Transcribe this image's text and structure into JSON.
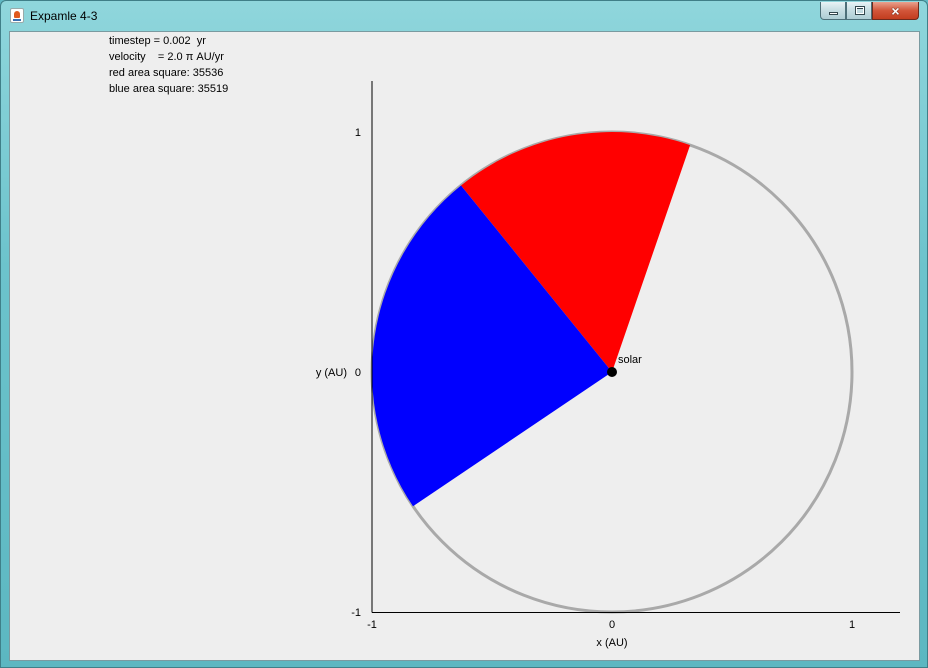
{
  "window": {
    "title": "Expamle 4-3",
    "controls": {
      "minimize": "minimize",
      "maximize": "maximize",
      "close": "×"
    }
  },
  "info": {
    "timestep": "timestep = 0.002  yr",
    "velocity": "velocity    = 2.0 π AU/yr",
    "red_area": "red area square: 35536",
    "blue_area": "blue area square: 35519"
  },
  "plot": {
    "x_label": "x (AU)",
    "y_label": "y (AU)",
    "x_ticks": [
      "-1",
      "0",
      "1"
    ],
    "y_ticks": [
      "1",
      "0",
      "-1"
    ],
    "sun_label": "solar",
    "orbit_color": "#a9a9a9",
    "red_color": "#ff0000",
    "blue_color": "#0000ff",
    "sun_color": "#000000"
  },
  "chart_data": {
    "type": "scatter",
    "xlabel": "x (AU)",
    "ylabel": "y (AU)",
    "xlim": [
      -1,
      1
    ],
    "ylim": [
      -1,
      1
    ],
    "orbit_radius": 1,
    "sun": {
      "x": 0,
      "y": 0,
      "label": "solar"
    },
    "red_sector_deg": [
      71,
      129
    ],
    "blue_sector_deg": [
      129,
      214
    ],
    "red_area": 35536,
    "blue_area": 35519
  }
}
